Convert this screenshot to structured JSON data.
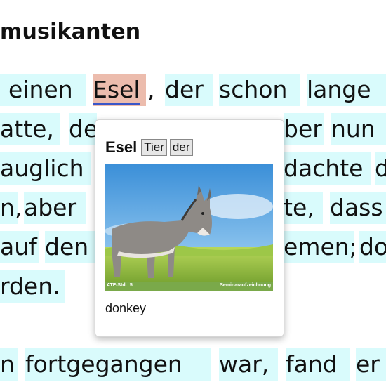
{
  "article": {
    "title": "musikanten",
    "lines": [
      [
        "einen",
        "Esel",
        ",",
        "der",
        "schon",
        "lange"
      ],
      [
        "atte,",
        "de",
        "ber",
        "nun"
      ],
      [
        "auglich",
        "dachte",
        "d"
      ],
      [
        "n,",
        "aber",
        "te,",
        "dass"
      ],
      [
        "auf",
        "den",
        "emen;",
        "do"
      ],
      [
        "rden."
      ],
      [
        "n",
        "fortgegangen",
        "war,",
        "fand",
        "er"
      ]
    ]
  },
  "popup": {
    "word": "Esel",
    "tags": [
      "Tier",
      "der"
    ],
    "image_alt": "donkey photo",
    "image_caption_left": "ATF-Std.: 5",
    "image_caption_right": "Seminaraufzeichnung",
    "definition": "donkey"
  },
  "colors": {
    "word_highlight": "#d9fbfc",
    "selected_highlight": "#ecbcad",
    "underline": "#3a56c8"
  }
}
